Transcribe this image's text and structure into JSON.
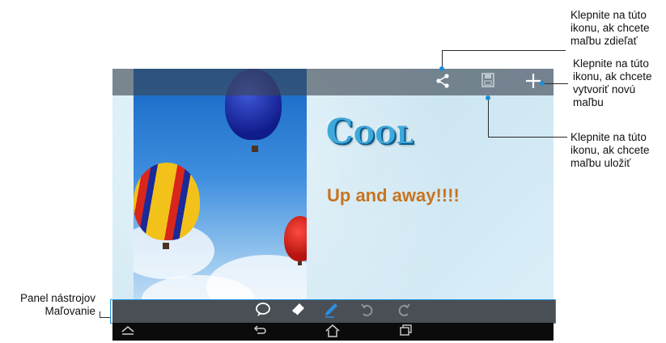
{
  "heading_fragment": "",
  "action_bar": {
    "share_icon": "share-icon",
    "save_icon": "save-icon",
    "add_icon": "plus-icon"
  },
  "canvas": {
    "logo_text": "Cool",
    "caption": "Up and away!!!!"
  },
  "toolbar": {
    "items": [
      "speech-bubble-icon",
      "eraser-icon",
      "pen-icon",
      "undo-icon",
      "redo-icon"
    ]
  },
  "navbar": {
    "items": [
      "up-chevron-icon",
      "back-icon",
      "home-icon",
      "recent-apps-icon"
    ]
  },
  "annotations": {
    "share": [
      "Klepnite na túto",
      "ikonu, ak chcete",
      "maľbu zdieľať"
    ],
    "new": [
      "Klepnite na túto",
      "ikonu, ak chcete",
      "vytvoriť novú",
      "maľbu"
    ],
    "save": [
      "Klepnite na túto",
      "ikonu, ak chcete",
      "maľbu uložiť"
    ],
    "toolbar": [
      "Panel nástrojov",
      "Maľovanie"
    ]
  },
  "colors": {
    "accent": "#1d8ed6",
    "caption": "#c8741f",
    "logo": "#3fa9dc"
  }
}
